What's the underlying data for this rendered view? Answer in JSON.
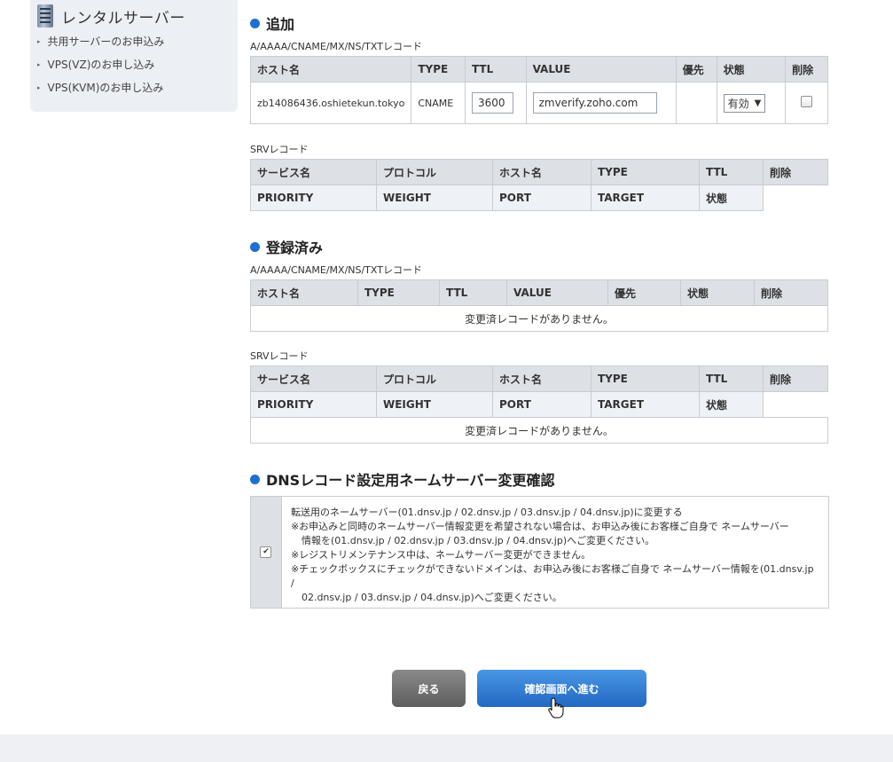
{
  "sidebar": {
    "title": "レンタルサーバー",
    "icon": "server-icon",
    "items": [
      {
        "label": "共用サーバーのお申込み"
      },
      {
        "label": "VPS(VZ)のお申し込み"
      },
      {
        "label": "VPS(KVM)のお申し込み"
      }
    ]
  },
  "add_section": {
    "title": "追加",
    "a_caption": "A/AAAA/CNAME/MX/NS/TXTレコード",
    "a_headers": [
      "ホスト名",
      "TYPE",
      "TTL",
      "VALUE",
      "優先",
      "状態",
      "削除"
    ],
    "a_row": {
      "host": "zb14086436.oshietekun.tokyo",
      "type": "CNAME",
      "ttl": "3600",
      "value": "zmverify.zoho.com",
      "priority": "",
      "status": "有効",
      "delete_checked": false
    },
    "srv_caption": "SRVレコード",
    "srv_headers": [
      "サービス名",
      "プロトコル",
      "ホスト名",
      "TYPE",
      "TTL",
      "削除"
    ],
    "srv_subheaders": [
      "PRIORITY",
      "WEIGHT",
      "PORT",
      "TARGET",
      "状態"
    ]
  },
  "registered_section": {
    "title": "登録済み",
    "a_caption": "A/AAAA/CNAME/MX/NS/TXTレコード",
    "a_headers": [
      "ホスト名",
      "TYPE",
      "TTL",
      "VALUE",
      "優先",
      "状態",
      "削除"
    ],
    "a_empty": "変更済レコードがありません。",
    "srv_caption": "SRVレコード",
    "srv_headers": [
      "サービス名",
      "プロトコル",
      "ホスト名",
      "TYPE",
      "TTL",
      "削除"
    ],
    "srv_subheaders": [
      "PRIORITY",
      "WEIGHT",
      "PORT",
      "TARGET",
      "状態"
    ],
    "srv_empty": "変更済レコードがありません。"
  },
  "ns_section": {
    "title": "DNSレコード設定用ネームサーバー変更確認",
    "checked": true,
    "lines": [
      "転送用のネームサーバー(01.dnsv.jp / 02.dnsv.jp / 03.dnsv.jp / 04.dnsv.jp)に変更する",
      "※お申込みと同時のネームサーバー情報変更を希望されない場合は、お申込み後にお客様ご自身で ネームサーバー",
      "情報を(01.dnsv.jp / 02.dnsv.jp / 03.dnsv.jp / 04.dnsv.jp)へご変更ください。",
      "※レジストリメンテナンス中は、ネームサーバー変更ができません。",
      "※チェックボックスにチェックができないドメインは、お申込み後にお客様ご自身で ネームサーバー情報を(01.dnsv.jp /",
      "02.dnsv.jp / 03.dnsv.jp / 04.dnsv.jp)へご変更ください。"
    ]
  },
  "buttons": {
    "back": "戻る",
    "next": "確認画面へ進む"
  },
  "colors": {
    "accent": "#1e6fd0",
    "header_bg": "#dde1e6",
    "next_button": "#2f7fd8",
    "back_button": "#6f6f6f"
  }
}
